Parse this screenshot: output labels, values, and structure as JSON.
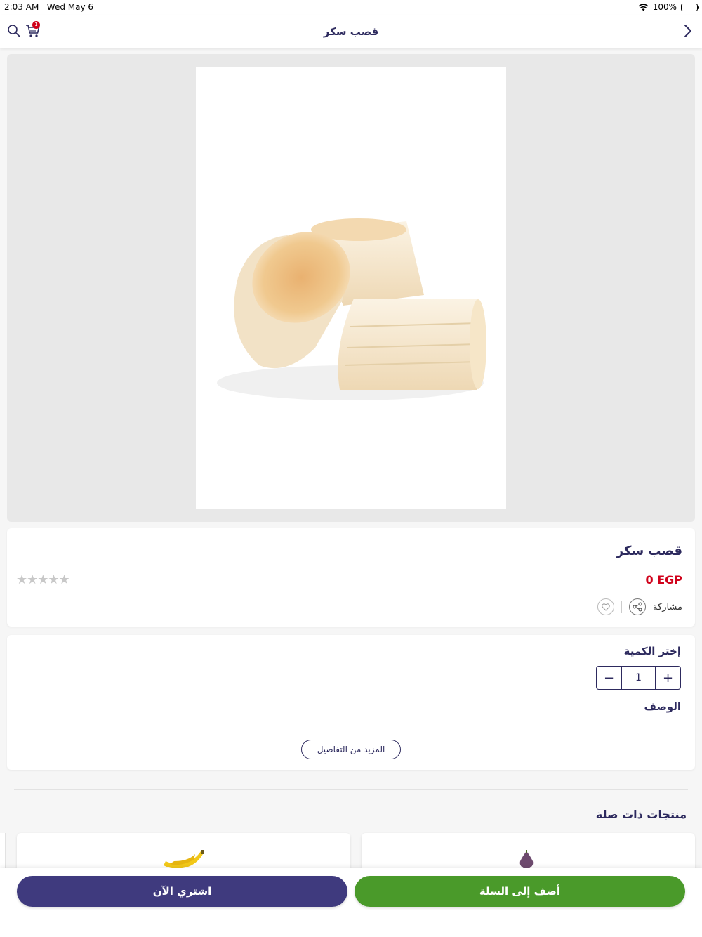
{
  "status_bar": {
    "time": "2:03 AM",
    "date": "Wed May 6",
    "battery": "100%"
  },
  "nav": {
    "title": "قصب سكر",
    "cart_count": "1"
  },
  "product": {
    "name": "قصب سكر",
    "price": "0 EGP",
    "rating_stars": "★★★★★",
    "share_label": "مشاركة"
  },
  "quantity": {
    "label": "إختر الكمية",
    "value": "1",
    "plus": "+",
    "minus": "−"
  },
  "description": {
    "label": "الوصف",
    "more_label": "المزيد من التفاصيل"
  },
  "related": {
    "title": "منتجات ذات صلة"
  },
  "actions": {
    "add_to_cart": "أضف إلى السلة",
    "buy_now": "اشتري الآن"
  },
  "colors": {
    "primary": "#3f3a7e",
    "accent_green": "#4a9a2a",
    "price_red": "#d0021b",
    "text": "#2d2a5e"
  }
}
